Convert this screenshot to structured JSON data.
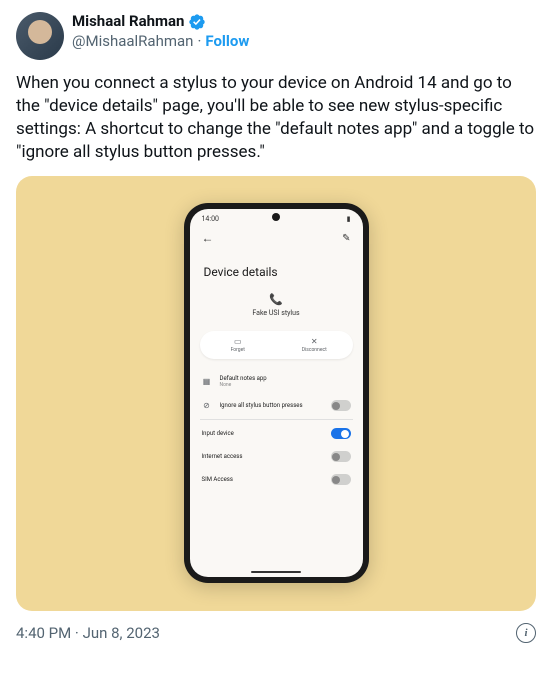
{
  "author": {
    "display_name": "Mishaal Rahman",
    "handle": "@MishaalRahman",
    "follow_label": "Follow"
  },
  "tweet_text": "When you connect a stylus to your device on Android 14 and go to the \"device details\" page, you'll be able to see new stylus-specific settings: A shortcut to change the \"default notes app\" and a toggle to \"ignore all stylus button presses.\"",
  "timestamp": "4:40 PM · Jun 8, 2023",
  "phone": {
    "status_time": "14:00",
    "title": "Device details",
    "device_name": "Fake USI stylus",
    "actions": {
      "forget": "Forget",
      "disconnect": "Disconnect"
    },
    "settings": {
      "default_notes": {
        "label": "Default notes app",
        "sublabel": "None"
      },
      "ignore_buttons": {
        "label": "Ignore all stylus button presses"
      },
      "input_device": {
        "label": "Input device"
      },
      "internet_access": {
        "label": "Internet access"
      },
      "sim_access": {
        "label": "SIM Access"
      }
    }
  }
}
